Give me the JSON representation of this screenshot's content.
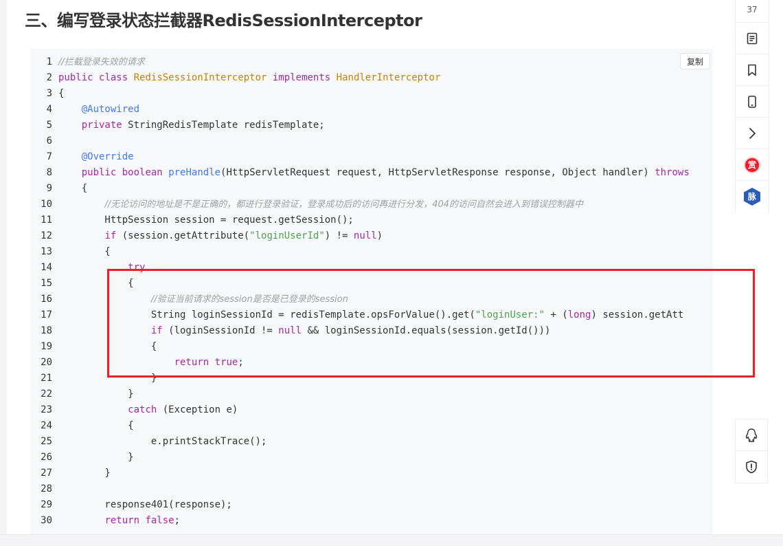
{
  "article": {
    "heading": "三、编写登录状态拦截器RedisSessionInterceptor"
  },
  "code_block": {
    "copy_label": "复制",
    "line_numbers": [
      "1",
      "2",
      "3",
      "4",
      "5",
      "6",
      "7",
      "8",
      "9",
      "10",
      "11",
      "12",
      "13",
      "14",
      "15",
      "16",
      "17",
      "18",
      "19",
      "20",
      "21",
      "22",
      "23",
      "24",
      "25",
      "26",
      "27",
      "28",
      "29",
      "30"
    ],
    "lines": [
      "//拦截登录失效的请求",
      "public class RedisSessionInterceptor implements HandlerInterceptor",
      "{",
      "    @Autowired",
      "    private StringRedisTemplate redisTemplate;",
      "",
      "    @Override",
      "    public boolean preHandle(HttpServletRequest request, HttpServletResponse response, Object handler) throws",
      "    {",
      "        //无论访问的地址是不是正确的，都进行登录验证，登录成功后的访问再进行分发，404的访问自然会进入到错误控制器中",
      "        HttpSession session = request.getSession();",
      "        if (session.getAttribute(\"loginUserId\") != null)",
      "        {",
      "            try",
      "            {",
      "                //验证当前请求的session是否是已登录的session",
      "                String loginSessionId = redisTemplate.opsForValue().get(\"loginUser:\" + (long) session.getAtt",
      "                if (loginSessionId != null && loginSessionId.equals(session.getId()))",
      "                {",
      "                    return true;",
      "                }",
      "            }",
      "            catch (Exception e)",
      "            {",
      "                e.printStackTrace();",
      "            }",
      "        }",
      "",
      "        response401(response);",
      "        return false;"
    ]
  },
  "sidebar": {
    "count": "37",
    "items": [
      "document-icon",
      "bookmark-icon",
      "mobile-icon",
      "chevron-right-icon"
    ],
    "reward_label": "赏",
    "contact_label": "脉",
    "bottom_items": [
      "qq-icon",
      "report-icon"
    ]
  },
  "colors": {
    "keyword": "#a626a4",
    "class": "#c18401",
    "function": "#4078f2",
    "string": "#50a14f",
    "comment": "#a0a1a7",
    "highlight_box": "#e8202a"
  }
}
